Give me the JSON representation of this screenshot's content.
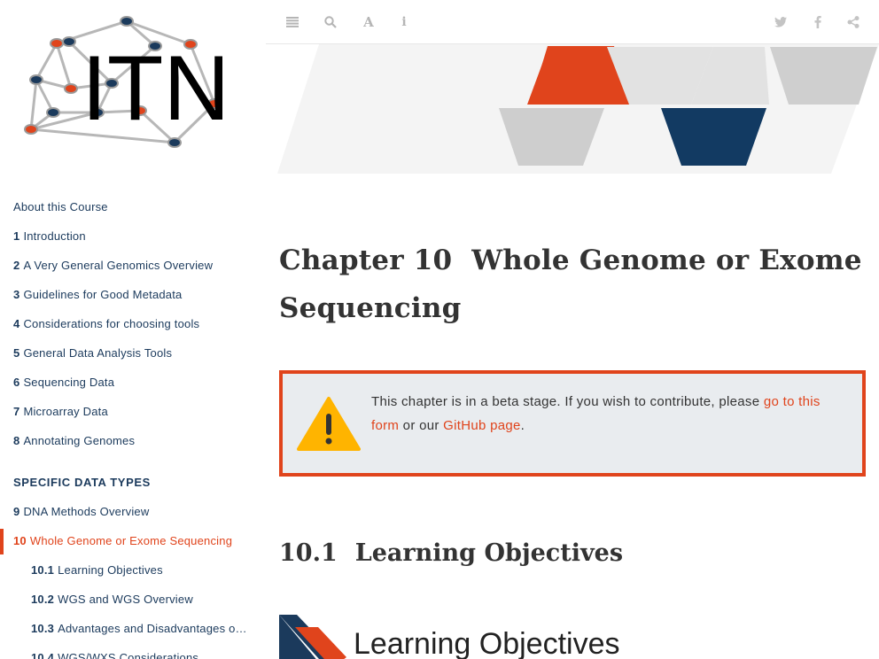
{
  "logo": {
    "text": "ITN"
  },
  "toolbar": {
    "left_icons": [
      "menu-icon",
      "search-icon",
      "font-icon",
      "info-icon"
    ],
    "right_icons": [
      "twitter-icon",
      "facebook-icon",
      "share-icon"
    ]
  },
  "sidebar": {
    "items": [
      {
        "num": "",
        "label": "About this Course"
      },
      {
        "num": "1",
        "label": "Introduction"
      },
      {
        "num": "2",
        "label": "A Very General Genomics Overview"
      },
      {
        "num": "3",
        "label": "Guidelines for Good Metadata"
      },
      {
        "num": "4",
        "label": "Considerations for choosing tools"
      },
      {
        "num": "5",
        "label": "General Data Analysis Tools"
      },
      {
        "num": "6",
        "label": "Sequencing Data"
      },
      {
        "num": "7",
        "label": "Microarray Data"
      },
      {
        "num": "8",
        "label": "Annotating Genomes"
      }
    ],
    "section_header": "SPECIFIC DATA TYPES",
    "items2": [
      {
        "num": "9",
        "label": "DNA Methods Overview"
      },
      {
        "num": "10",
        "label": "Whole Genome or Exome Sequencing"
      },
      {
        "num": "10.1",
        "label": "Learning Objectives"
      },
      {
        "num": "10.2",
        "label": "WGS and WGS Overview"
      },
      {
        "num": "10.3",
        "label": "Advantages and Disadvantages of WGS vs WXS"
      },
      {
        "num": "10.4",
        "label": "WGS/WXS Considerations"
      }
    ]
  },
  "main": {
    "chapter_number": "Chapter 10",
    "chapter_title": "Whole Genome or Exome Sequencing",
    "callout": {
      "text_before": "This chapter is in a beta stage. If you wish to contribute, please ",
      "link1": "go to this form",
      "text_middle": " or our ",
      "link2": "GitHub page",
      "text_after": "."
    },
    "section_number": "10.1",
    "section_title": "Learning Objectives",
    "lo_banner_title": "Learning Objectives"
  },
  "colors": {
    "accent": "#e0441c",
    "navy": "#1b3a5c",
    "callout_bg": "#e9ecef"
  }
}
